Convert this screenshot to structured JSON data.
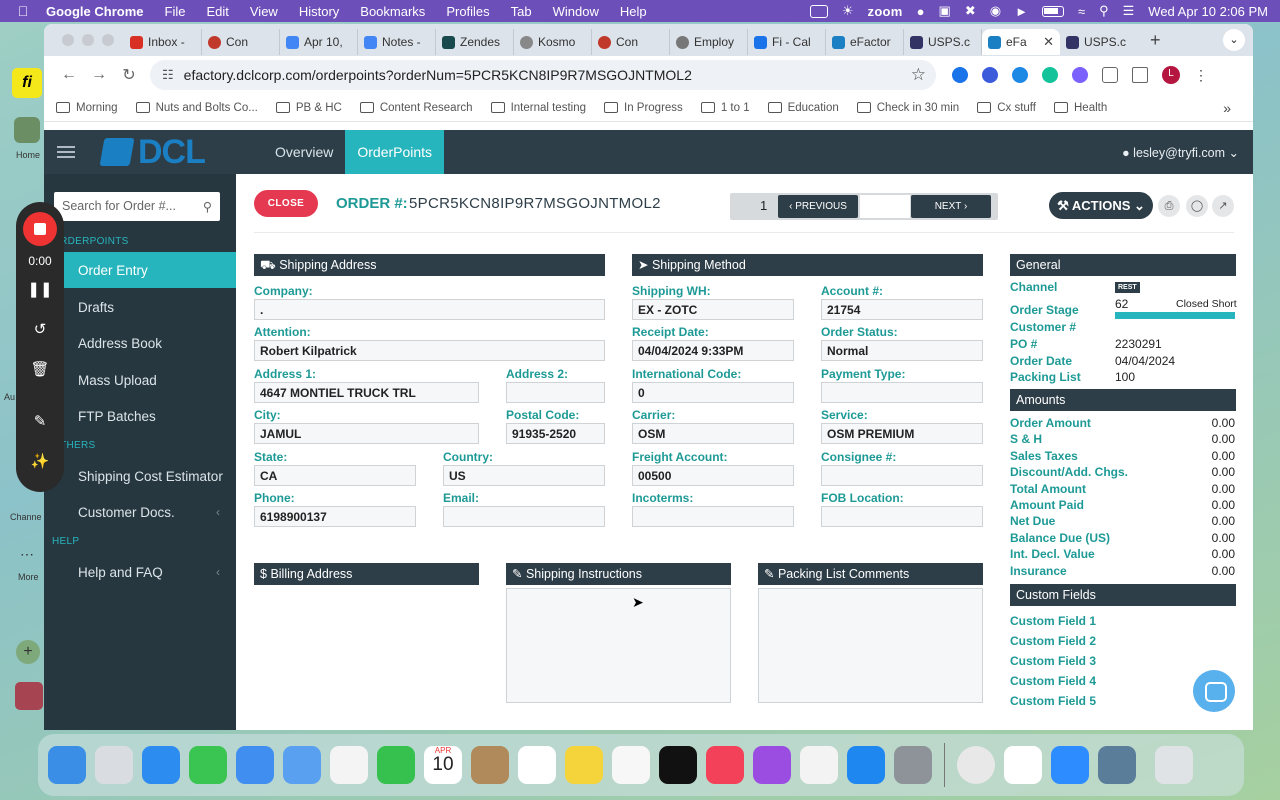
{
  "menubar": {
    "app": "Google Chrome",
    "items": [
      "File",
      "Edit",
      "View",
      "History",
      "Bookmarks",
      "Profiles",
      "Tab",
      "Window",
      "Help"
    ],
    "zoom_label": "zoom",
    "datetime": "Wed Apr 10  2:06 PM"
  },
  "slack_strip": {
    "home_label": "Home",
    "activity_label": "Au",
    "channels_label": "Channe",
    "more_label": "More"
  },
  "recorder": {
    "time": "0:00"
  },
  "browser": {
    "tabs": [
      {
        "label": "Inbox -",
        "color": "#d93025"
      },
      {
        "label": "Con",
        "color": "#c0392b"
      },
      {
        "label": "Apr 10,",
        "color": "#4285f4"
      },
      {
        "label": "Notes -",
        "color": "#4285f4"
      },
      {
        "label": "Zendes",
        "color": "#17494d"
      },
      {
        "label": "Kosmo",
        "color": "#888888"
      },
      {
        "label": "Con",
        "color": "#c0392b"
      },
      {
        "label": "Employ",
        "color": "#777777"
      },
      {
        "label": "Fi - Cal",
        "color": "#1a73e8"
      },
      {
        "label": "eFactor",
        "color": "#1b7fc4"
      },
      {
        "label": "USPS.c",
        "color": "#333366"
      },
      {
        "label": "eFa",
        "color": "#1b7fc4"
      },
      {
        "label": "USPS.c",
        "color": "#333366"
      }
    ],
    "url": "efactory.dclcorp.com/orderpoints?orderNum=5PCR5KCN8IP9R7MSGOJNTMOL2",
    "profile_initial": "L",
    "bookmarks": [
      "Morning",
      "Nuts and Bolts Co...",
      "PB & HC",
      "Content Research",
      "Internal testing",
      "In Progress",
      "1 to 1",
      "Education",
      "Check in 30 min",
      "Cx stuff",
      "Health"
    ]
  },
  "app": {
    "logo": "DCL",
    "nav": [
      "Overview",
      "OrderPoints"
    ],
    "user": "lesley@tryfi.com"
  },
  "sidebar": {
    "search_placeholder": "Search for Order #...",
    "section_orderpoints": "ORDERPOINTS",
    "items_main": [
      "Order Entry",
      "Drafts",
      "Address Book",
      "Mass Upload",
      "FTP Batches"
    ],
    "section_others": "OTHERS",
    "items_others": [
      "Shipping Cost Estimator",
      "Customer Docs."
    ],
    "section_help": "HELP",
    "items_help": [
      "Help and FAQ"
    ]
  },
  "order": {
    "close_label": "CLOSE",
    "order_label": "ORDER #:",
    "order_number": "5PCR5KCN8IP9R7MSGOJNTMOL2",
    "page": "1",
    "prev_label": "PREVIOUS",
    "next_label": "NEXT",
    "actions_label": "ACTIONS"
  },
  "shipping_address": {
    "title": "Shipping Address",
    "company_label": "Company:",
    "company": ".",
    "attention_label": "Attention:",
    "attention": "Robert Kilpatrick",
    "address1_label": "Address 1:",
    "address1": "4647 MONTIEL TRUCK TRL",
    "address2_label": "Address 2:",
    "address2": "",
    "city_label": "City:",
    "city": "JAMUL",
    "postal_label": "Postal Code:",
    "postal": "91935-2520",
    "state_label": "State:",
    "state": "CA",
    "country_label": "Country:",
    "country": "US",
    "phone_label": "Phone:",
    "phone": "6198900137",
    "email_label": "Email:",
    "email": ""
  },
  "shipping_method": {
    "title": "Shipping Method",
    "wh_label": "Shipping WH:",
    "wh": "EX - ZOTC",
    "account_label": "Account #:",
    "account": "21754",
    "receipt_label": "Receipt Date:",
    "receipt": "04/04/2024 9:33PM",
    "status_label": "Order Status:",
    "status": "Normal",
    "intl_label": "International Code:",
    "intl": "0",
    "payment_label": "Payment Type:",
    "payment": "",
    "carrier_label": "Carrier:",
    "carrier": "OSM",
    "service_label": "Service:",
    "service": "OSM PREMIUM",
    "freight_label": "Freight Account:",
    "freight": "00500",
    "consignee_label": "Consignee #:",
    "consignee": "",
    "incoterms_label": "Incoterms:",
    "incoterms": "",
    "fob_label": "FOB Location:",
    "fob": ""
  },
  "general": {
    "title": "General",
    "channel_label": "Channel",
    "channel_badge": "REST",
    "stage_label": "Order Stage",
    "stage_value": "62",
    "stage_status": "Closed Short",
    "stage_progress": 1.0,
    "customer_label": "Customer #",
    "customer": "",
    "po_label": "PO #",
    "po": "2230291",
    "date_label": "Order Date",
    "date": "04/04/2024",
    "packing_label": "Packing List",
    "packing": "100"
  },
  "amounts": {
    "title": "Amounts",
    "rows": [
      {
        "label": "Order Amount",
        "value": "0.00"
      },
      {
        "label": "S & H",
        "value": "0.00"
      },
      {
        "label": "Sales Taxes",
        "value": "0.00"
      },
      {
        "label": "Discount/Add. Chgs.",
        "value": "0.00"
      },
      {
        "label": "Total Amount",
        "value": "0.00"
      },
      {
        "label": "Amount Paid",
        "value": "0.00"
      },
      {
        "label": "Net Due",
        "value": "0.00"
      },
      {
        "label": "Balance Due (US)",
        "value": "0.00"
      },
      {
        "label": "Int. Decl. Value",
        "value": "0.00"
      },
      {
        "label": "Insurance",
        "value": "0.00"
      }
    ]
  },
  "custom_fields": {
    "title": "Custom Fields",
    "items": [
      "Custom Field 1",
      "Custom Field 2",
      "Custom Field 3",
      "Custom Field 4",
      "Custom Field 5"
    ]
  },
  "billing": {
    "title": "Billing Address"
  },
  "instructions": {
    "title": "Shipping Instructions"
  },
  "packing_comments": {
    "title": "Packing List Comments"
  },
  "dock": {
    "calendar_month": "APR",
    "calendar_day": "10"
  }
}
